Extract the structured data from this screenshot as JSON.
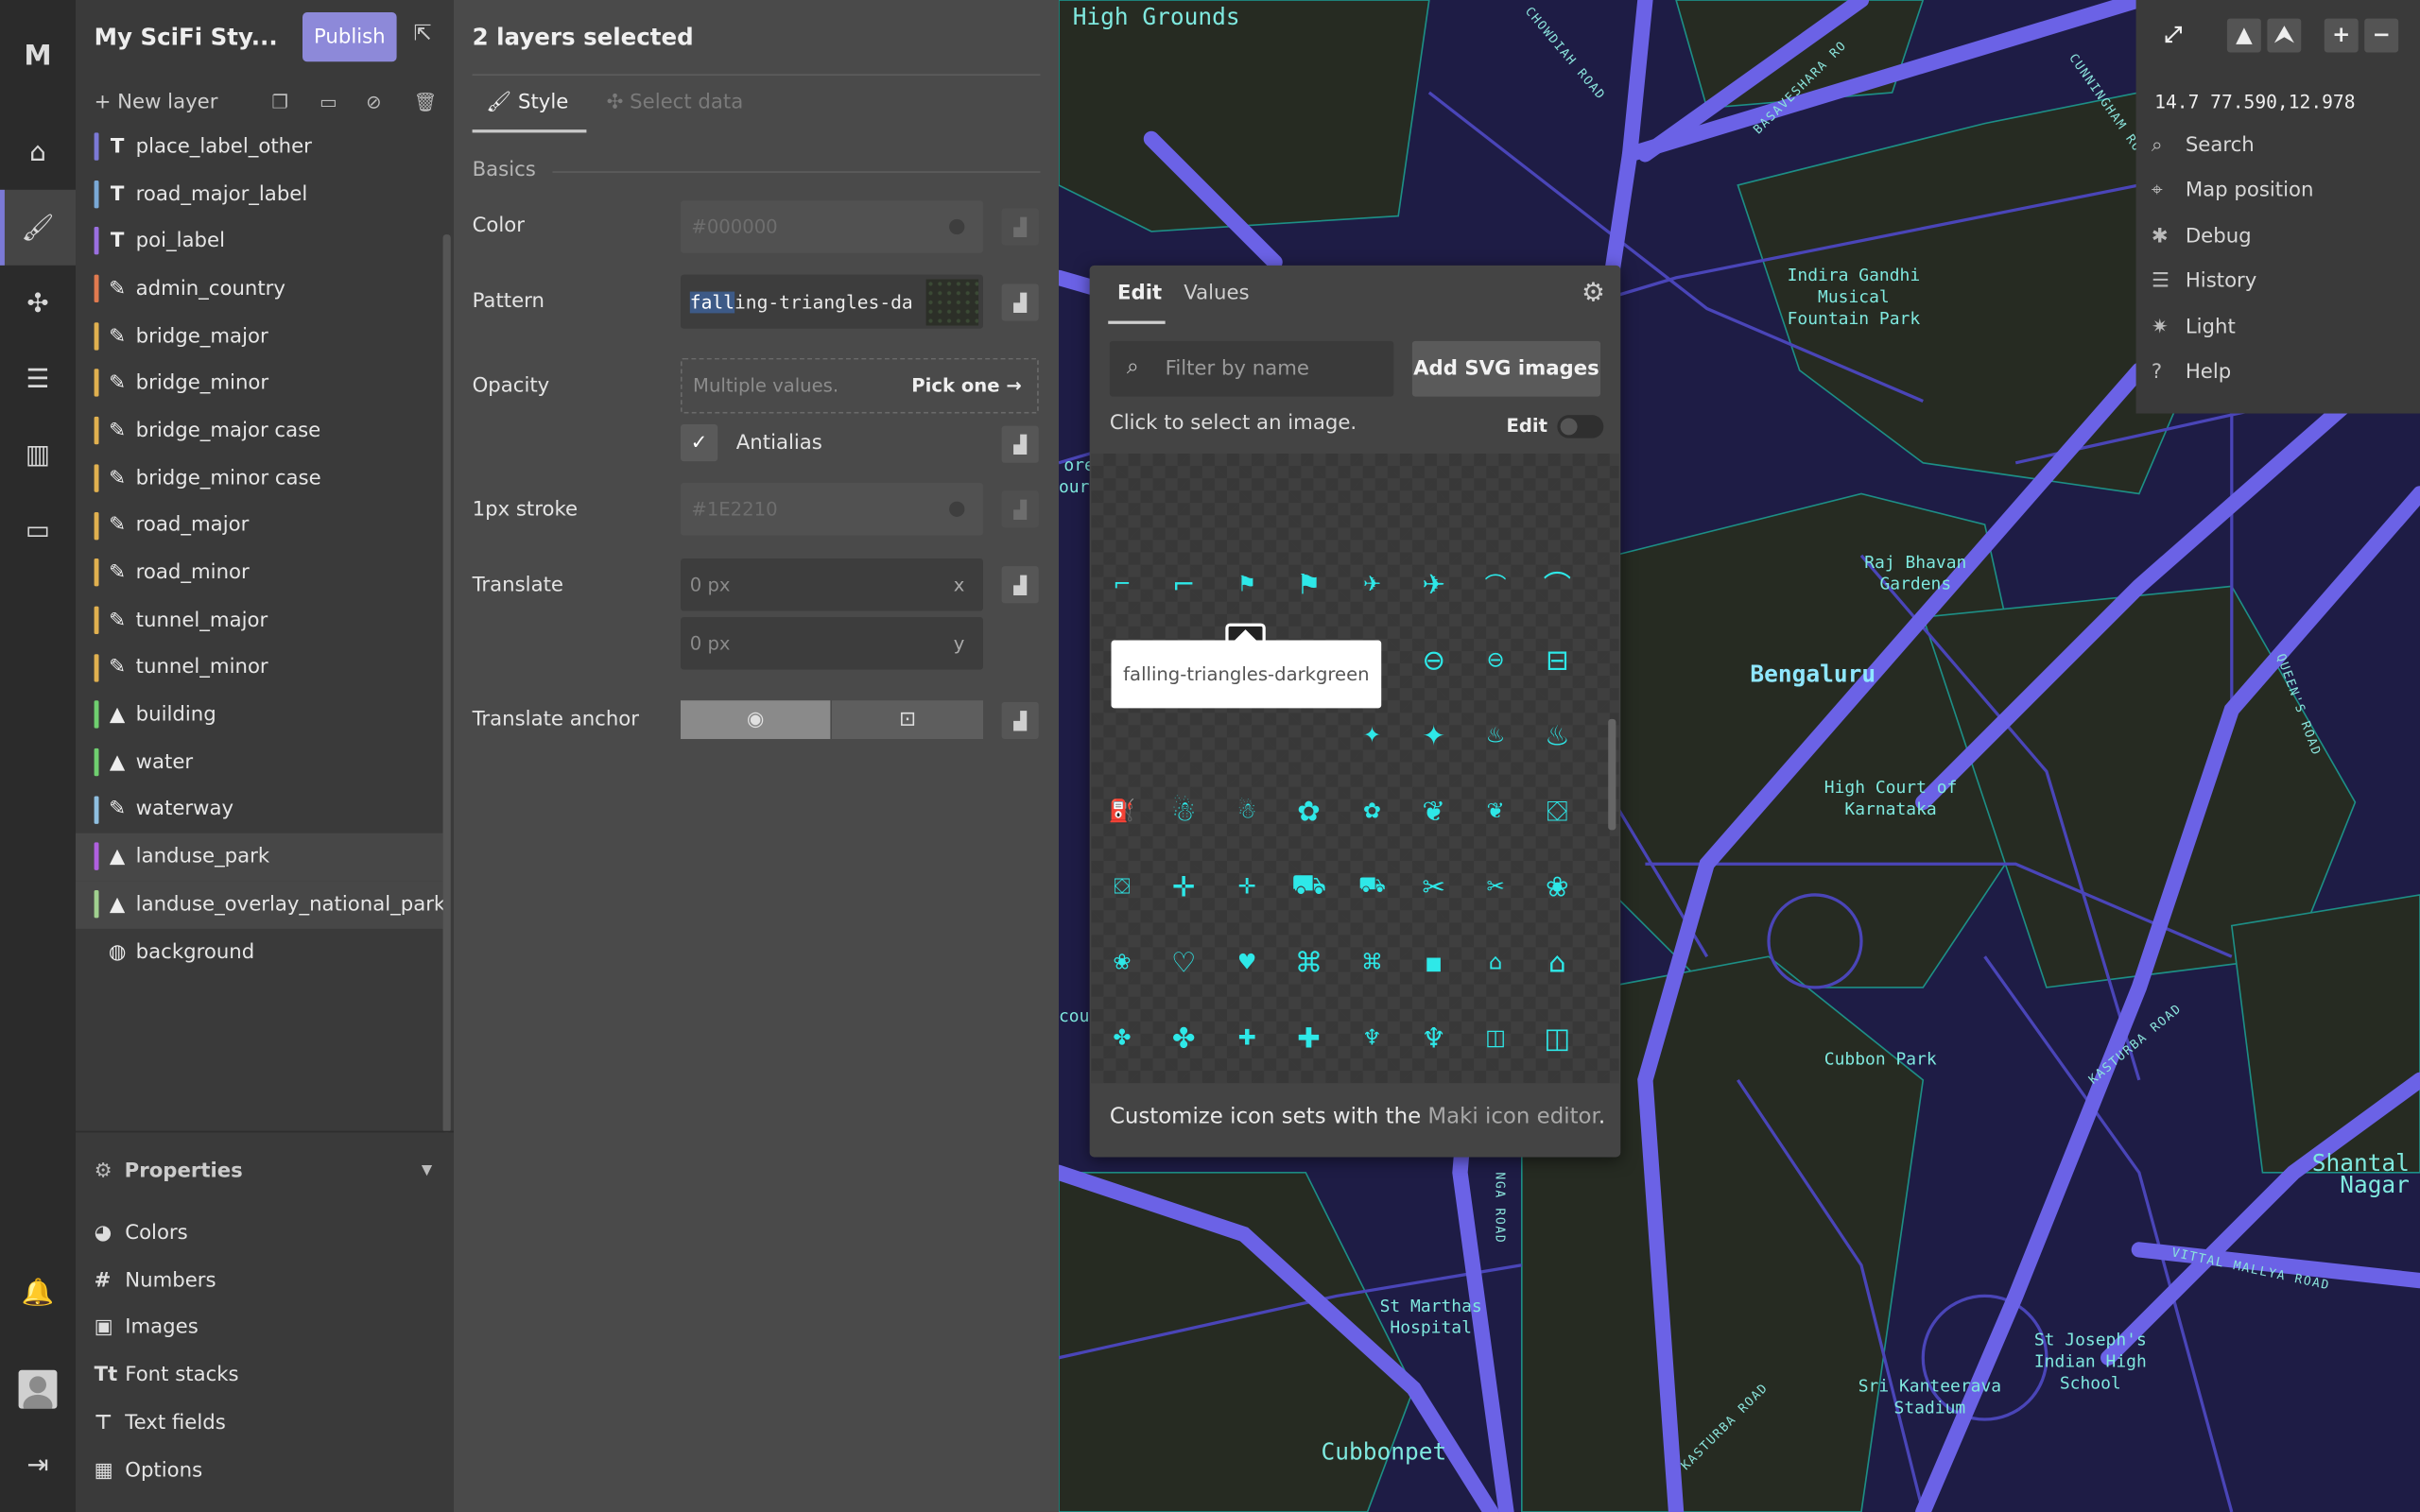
{
  "rail": {
    "logo": "M"
  },
  "layers_panel": {
    "title": "My SciFi Sty...",
    "publish_label": "Publish",
    "new_layer_label": "New layer",
    "layers": [
      {
        "name": "place_label_other",
        "icon": "T",
        "color": "#7b79d6"
      },
      {
        "name": "road_major_label",
        "icon": "T",
        "color": "#7aa9d6"
      },
      {
        "name": "poi_label",
        "icon": "T",
        "color": "#9a6fe0"
      },
      {
        "name": "admin_country",
        "icon": "pencil-icon",
        "color": "#e07a4f"
      },
      {
        "name": "bridge_major",
        "icon": "pencil-icon",
        "color": "#e0b04f"
      },
      {
        "name": "bridge_minor",
        "icon": "pencil-icon",
        "color": "#e0b04f"
      },
      {
        "name": "bridge_major case",
        "icon": "pencil-icon",
        "color": "#e0b04f"
      },
      {
        "name": "bridge_minor case",
        "icon": "pencil-icon",
        "color": "#e0b04f"
      },
      {
        "name": "road_major",
        "icon": "pencil-icon",
        "color": "#e0b04f"
      },
      {
        "name": "road_minor",
        "icon": "pencil-icon",
        "color": "#e0b04f"
      },
      {
        "name": "tunnel_major",
        "icon": "pencil-icon",
        "color": "#e0b04f"
      },
      {
        "name": "tunnel_minor",
        "icon": "pencil-icon",
        "color": "#e0b04f"
      },
      {
        "name": "building",
        "icon": "fill-icon",
        "color": "#6fcf6f"
      },
      {
        "name": "water",
        "icon": "fill-icon",
        "color": "#6fcf6f"
      },
      {
        "name": "waterway",
        "icon": "pencil-icon",
        "color": "#8fbfe0"
      },
      {
        "name": "landuse_park",
        "icon": "fill-icon",
        "color": "#b060e0",
        "selected": true
      },
      {
        "name": "landuse_overlay_national_park",
        "icon": "fill-icon",
        "color": "#a0d08f",
        "selected": true
      },
      {
        "name": "background",
        "icon": "globe-icon",
        "color": ""
      }
    ],
    "properties_label": "Properties",
    "property_items": [
      {
        "label": "Colors",
        "icon": "palette-icon"
      },
      {
        "label": "Numbers",
        "icon": "hash-icon"
      },
      {
        "label": "Images",
        "icon": "image-icon"
      },
      {
        "label": "Font stacks",
        "icon": "font-icon"
      },
      {
        "label": "Text fields",
        "icon": "text-field-icon"
      },
      {
        "label": "Options",
        "icon": "grid-icon"
      }
    ]
  },
  "style_panel": {
    "title": "2 layers selected",
    "tab_style": "Style",
    "tab_data": "Select data",
    "section": "Basics",
    "color_label": "Color",
    "color_value": "#000000",
    "pattern_label": "Pattern",
    "pattern_highlight": "fall",
    "pattern_rest": "ing-triangles-da",
    "opacity_label": "Opacity",
    "opacity_placeholder": "Multiple values.",
    "pick_one": "Pick one",
    "antialias_label": "Antialias",
    "stroke_label": "1px stroke",
    "stroke_value": "#1E2210",
    "translate_label": "Translate",
    "translate_x": "0 px",
    "translate_x_axis": "x",
    "translate_y": "0 px",
    "translate_y_axis": "y",
    "anchor_label": "Translate anchor"
  },
  "picker": {
    "tab_edit": "Edit",
    "tab_values": "Values",
    "search_placeholder": "Filter by name",
    "add_svg": "Add SVG images",
    "hint": "Click to select an image.",
    "edit_label": "Edit",
    "tooltip": "falling-triangles-darkgreen",
    "footer_pre": "Customize icon sets with the ",
    "footer_link": "Maki icon editor",
    "footer_post": ".",
    "icon_color": "#2ee8e8"
  },
  "map_controls": {
    "coords": "14.7 77.590,12.978",
    "items": [
      "Search",
      "Map position",
      "Debug",
      "History",
      "Light",
      "Help"
    ]
  },
  "map_labels": {
    "high_grounds": "High Grounds",
    "indira": "Indira Gandhi\nMusical\nFountain Park",
    "raj_bhavan": "Raj Bhavan\nGardens",
    "bengaluru": "Bengaluru",
    "high_court": "High Court of\nKarnataka",
    "cubbon_park": "Cubbon Park",
    "st_marthas": "St Marthas\nHospital",
    "cubbonpet": "Cubbonpet",
    "sri_kanteerava": "Sri Kanteerava\nStadium",
    "st_josephs": "St Joseph's\nIndian High\nSchool",
    "shantala": "Shantal\nNagar",
    "lore": "ore\nours",
    "cour": "cour",
    "road_chowdiah": "CHOWDIAH ROAD",
    "road_cunningham": "CUNNINGHAM RO",
    "road_queens": "QUEEN'S ROAD",
    "road_kasturba": "KASTURBA ROAD",
    "road_kasturba2": "KASTURBA ROAD",
    "road_vittal": "VITTAL MALLYA ROAD",
    "road_nga": "NGA ROAD",
    "road_basave": "BASAVESHARA RO"
  }
}
